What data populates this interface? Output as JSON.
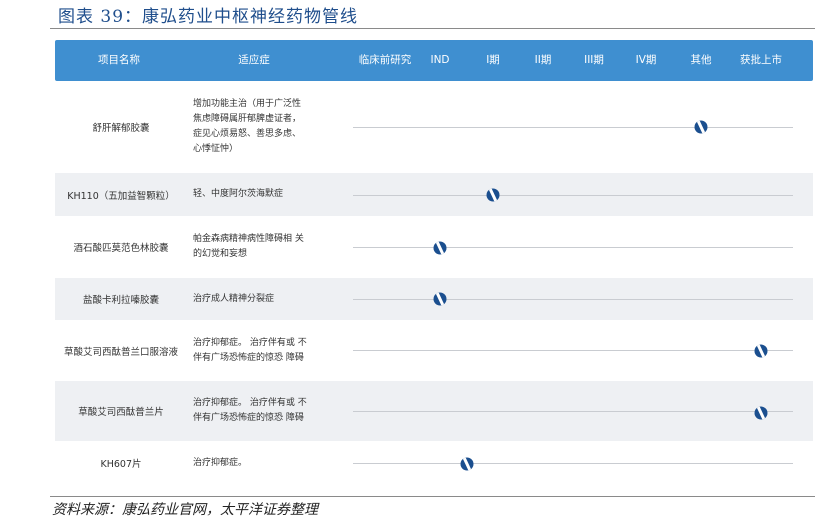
{
  "figure": {
    "title": "图表 39：康弘药业中枢神经药物管线",
    "source": "资料来源：康弘药业官网，太平洋证券整理"
  },
  "table": {
    "headers": {
      "drug": "项目名称",
      "indication": "适应症",
      "stages": [
        "临床前研究",
        "IND",
        "I期",
        "II期",
        "III期",
        "IV期",
        "其他",
        "获批上市"
      ]
    },
    "rows": [
      {
        "drug": "舒肝解郁胶囊",
        "indication": [
          "增加功能主治（用于广泛性",
          "焦虑障碍属肝郁脾虚证者，",
          "症见心烦易怒、善思多虑、",
          "心悸怔忡）"
        ],
        "stage_index": 6,
        "stage": "其他"
      },
      {
        "drug": "KH110（五加益智颗粒）",
        "indication": [
          "轻、中度阿尔茨海默症"
        ],
        "stage_index": 2,
        "stage": "I期"
      },
      {
        "drug": "酒石酸匹莫范色林胶囊",
        "indication": [
          "帕金森病精神病性障碍相 关",
          "的幻觉和妄想"
        ],
        "stage_index": 1,
        "stage": "IND"
      },
      {
        "drug": "盐酸卡利拉嗪胶囊",
        "indication": [
          "治疗成人精神分裂症"
        ],
        "stage_index": 1,
        "stage": "IND"
      },
      {
        "drug": "草酸艾司西酞普兰口服溶液",
        "indication": [
          "治疗抑郁症。 治疗伴有或 不",
          "伴有广场恐怖症的惊恐 障碍"
        ],
        "stage_index": 7,
        "stage": "获批上市"
      },
      {
        "drug": "草酸艾司西酞普兰片",
        "indication": [
          "治疗抑郁症。 治疗伴有或 不",
          "伴有广场恐怖症的惊恐 障碍"
        ],
        "stage_index": 7,
        "stage": "获批上市"
      },
      {
        "drug": "KH607片",
        "indication": [
          "治疗抑郁症。"
        ],
        "stage_index": 1.5,
        "stage": "IND–I期"
      }
    ]
  },
  "colors": {
    "header_bg": "#3f8fd0",
    "marker": "#1b4f8f",
    "title": "#1f4e8c",
    "row_alt": "#eef0f3"
  }
}
